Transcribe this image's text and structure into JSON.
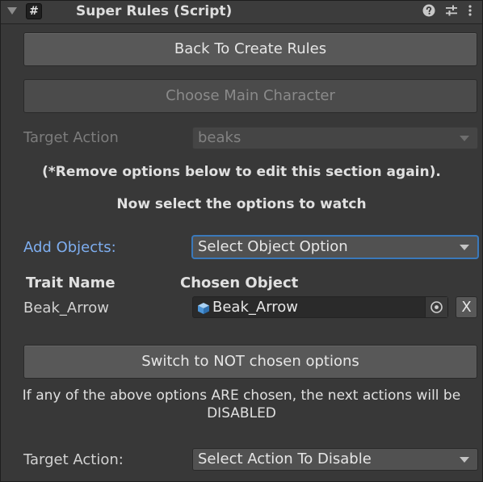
{
  "header": {
    "script_icon": "#",
    "title": "Super Rules (Script)",
    "icons": [
      "help-icon",
      "preset-sliders-icon",
      "kebab-menu-icon"
    ]
  },
  "buttons": {
    "back_to_create_rules": "Back To Create Rules",
    "choose_main_character": "Choose Main Character",
    "switch_to_not_chosen": "Switch to NOT chosen options",
    "remove_object": "X"
  },
  "target_action": {
    "label": "Target Action",
    "value": "beaks"
  },
  "notes": {
    "remove_options": "(*Remove options below to edit this section again).",
    "select_options": "Now select the options to watch"
  },
  "add_objects": {
    "label": "Add Objects:",
    "value": "Select Object Option"
  },
  "table": {
    "headers": [
      "Trait Name",
      "Chosen Object"
    ],
    "rows": [
      {
        "trait": "Beak_Arrow",
        "object": "Beak_Arrow"
      }
    ]
  },
  "disabled_note": {
    "line1": "If any of the above options ARE chosen, the next actions will be",
    "line2": "DISABLED"
  },
  "target_action_disable": {
    "label": "Target Action:",
    "value": "Select Action To Disable"
  },
  "colors": {
    "background": "#383838",
    "button": "#585858",
    "accent_label": "#7eaef0",
    "focus_border": "#3a79bb"
  }
}
